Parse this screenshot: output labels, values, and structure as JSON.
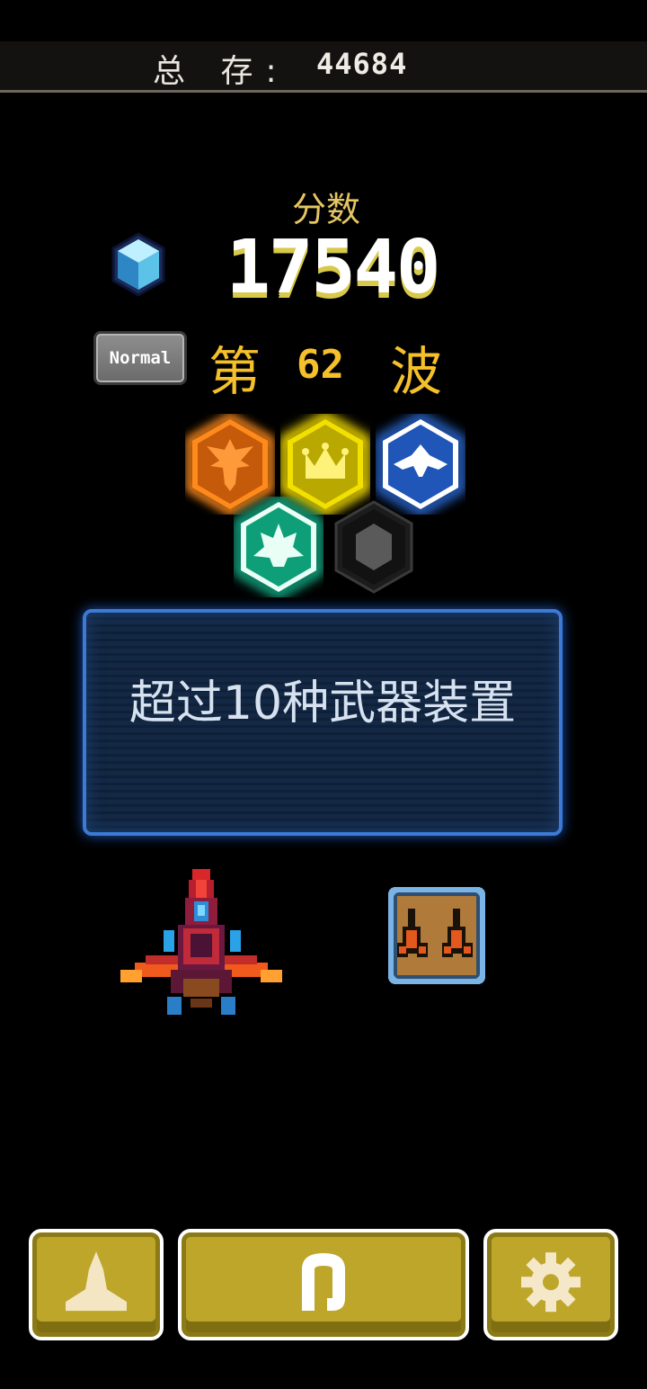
{
  "header": {
    "total_label": "总 存:",
    "total_value": "44684"
  },
  "score": {
    "label": "分数",
    "value": "17540"
  },
  "difficulty": {
    "badge": "Normal"
  },
  "wave": {
    "prefix": "第",
    "number": "62",
    "suffix": "波"
  },
  "achievements": [
    {
      "name": "orange-eagle-badge",
      "color": "#ff8a1c",
      "unlocked": true
    },
    {
      "name": "yellow-crown-badge",
      "color": "#ffe600",
      "unlocked": true
    },
    {
      "name": "blue-manta-badge",
      "color": "#2a6bd8",
      "unlocked": true
    },
    {
      "name": "teal-ship-badge",
      "color": "#16b48c",
      "unlocked": true
    },
    {
      "name": "locked-badge",
      "color": "#333333",
      "unlocked": false
    }
  ],
  "tip": {
    "text": "超过10种武器装置"
  },
  "bottom_bar": {
    "buttons": [
      {
        "name": "hangar-button",
        "icon": "ship-icon"
      },
      {
        "name": "retry-button",
        "icon": "restart-icon"
      },
      {
        "name": "settings-button",
        "icon": "gear-icon"
      }
    ]
  },
  "colors": {
    "accent_gold": "#f5c02a",
    "panel_blue": "#3c7ad4",
    "button_gold": "#bda62a"
  }
}
